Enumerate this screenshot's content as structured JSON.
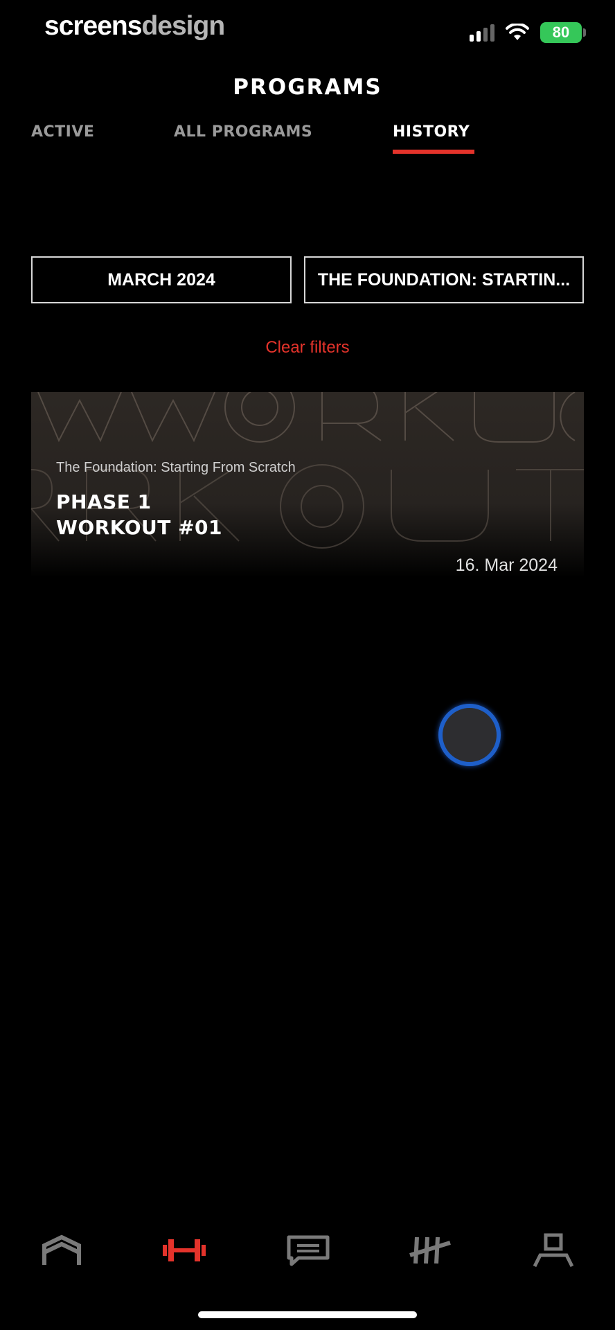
{
  "status_bar": {
    "brand_bold": "screens",
    "brand_light": "design",
    "battery": "80",
    "icons": [
      "signal-icon",
      "wifi-icon",
      "battery-icon"
    ]
  },
  "header": {
    "title": "PROGRAMS",
    "tabs": [
      {
        "label": "ACTIVE",
        "active": false
      },
      {
        "label": "ALL PROGRAMS",
        "active": false
      },
      {
        "label": "HISTORY",
        "active": true
      }
    ]
  },
  "filters": {
    "month": "MARCH 2024",
    "program": "THE FOUNDATION: STARTIN...",
    "clear_label": "Clear filters"
  },
  "history": [
    {
      "program": "The Foundation: Starting From Scratch",
      "phase": "PHASE 1",
      "workout": "WORKOUT #01",
      "date": "16. Mar 2024"
    }
  ],
  "nav": {
    "items": [
      {
        "icon": "home-icon",
        "active": false
      },
      {
        "icon": "dumbbell-icon",
        "active": true
      },
      {
        "icon": "chat-icon",
        "active": false
      },
      {
        "icon": "tally-icon",
        "active": false
      },
      {
        "icon": "profile-icon",
        "active": false
      }
    ]
  },
  "colors": {
    "accent": "#e4332b",
    "background": "#000000",
    "inactive": "#9a9a9a",
    "battery": "#35c759",
    "touch_ring": "#1e5fc9"
  }
}
